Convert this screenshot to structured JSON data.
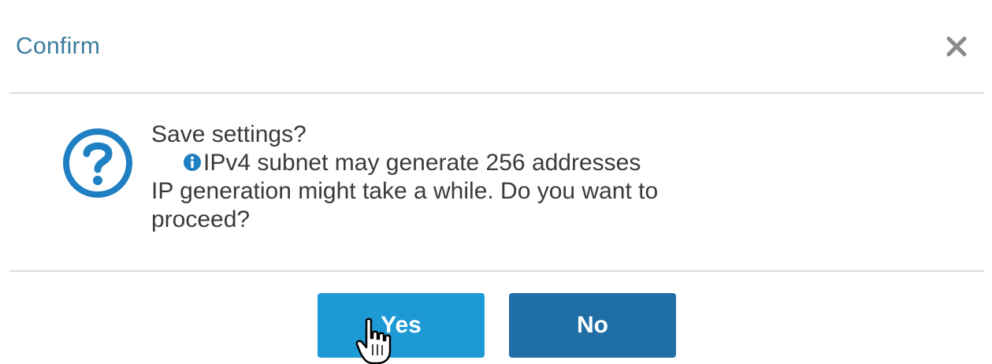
{
  "dialog": {
    "title": "Confirm",
    "close_icon": "close-icon",
    "question_icon": "question-circle-icon",
    "message": {
      "heading": "Save settings?",
      "info_icon": "info-icon",
      "info_text": "IPv4 subnet may generate 256 addresses",
      "line3": "IP generation might take a while. Do you want to",
      "line4": "proceed?"
    },
    "buttons": {
      "yes_label": "Yes",
      "no_label": "No"
    }
  },
  "colors": {
    "title": "#3b7d9c",
    "yes_button": "#1d9ad6",
    "no_button": "#1f6ea6",
    "icon_blue": "#1f7fc3"
  },
  "cursor_icon": "hand-pointer-icon"
}
